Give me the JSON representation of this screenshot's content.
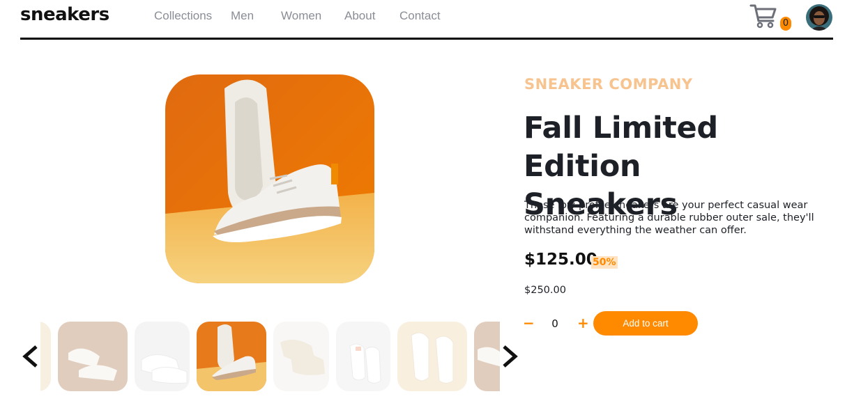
{
  "header": {
    "logo": "sneakers",
    "nav": [
      "Collections",
      "Men",
      "Women",
      "About",
      "Contact"
    ],
    "cart_count": "0",
    "cart_icon": "cart-icon",
    "avatar_icon": "user-avatar"
  },
  "gallery": {
    "main_image": "sneaker-pair-on-orange-background",
    "thumbnails": [
      "sneaker-partial",
      "sneakers-beige-top-view",
      "sneakers-white-pair",
      "sneakers-orange-background",
      "sneakers-cream-pair",
      "sneakers-white-pink",
      "sneakers-white-flatlay",
      "sneakers-partial-right"
    ],
    "active_thumbnail": 3,
    "prev_icon": "chevron-left-icon",
    "next_icon": "chevron-right-icon"
  },
  "product": {
    "company": "SNEAKER COMPANY",
    "title_line1": "Fall Limited Edition",
    "title_line2": "Sneakers",
    "description": "These low-profile sneakers are your perfect casual wear companion. Featuring a durable rubber outer sale, they'll withstand everything the weather can offer.",
    "price": "$125.00",
    "discount": "50%",
    "old_price": "$250.00",
    "quantity": "0",
    "minus_label": "−",
    "plus_label": "+",
    "add_to_cart": "Add to cart"
  },
  "colors": {
    "accent": "#ff8a00",
    "accent_pale": "#f7c38f",
    "text_dark": "#1d2026",
    "nav_gray": "#8a8d96"
  }
}
